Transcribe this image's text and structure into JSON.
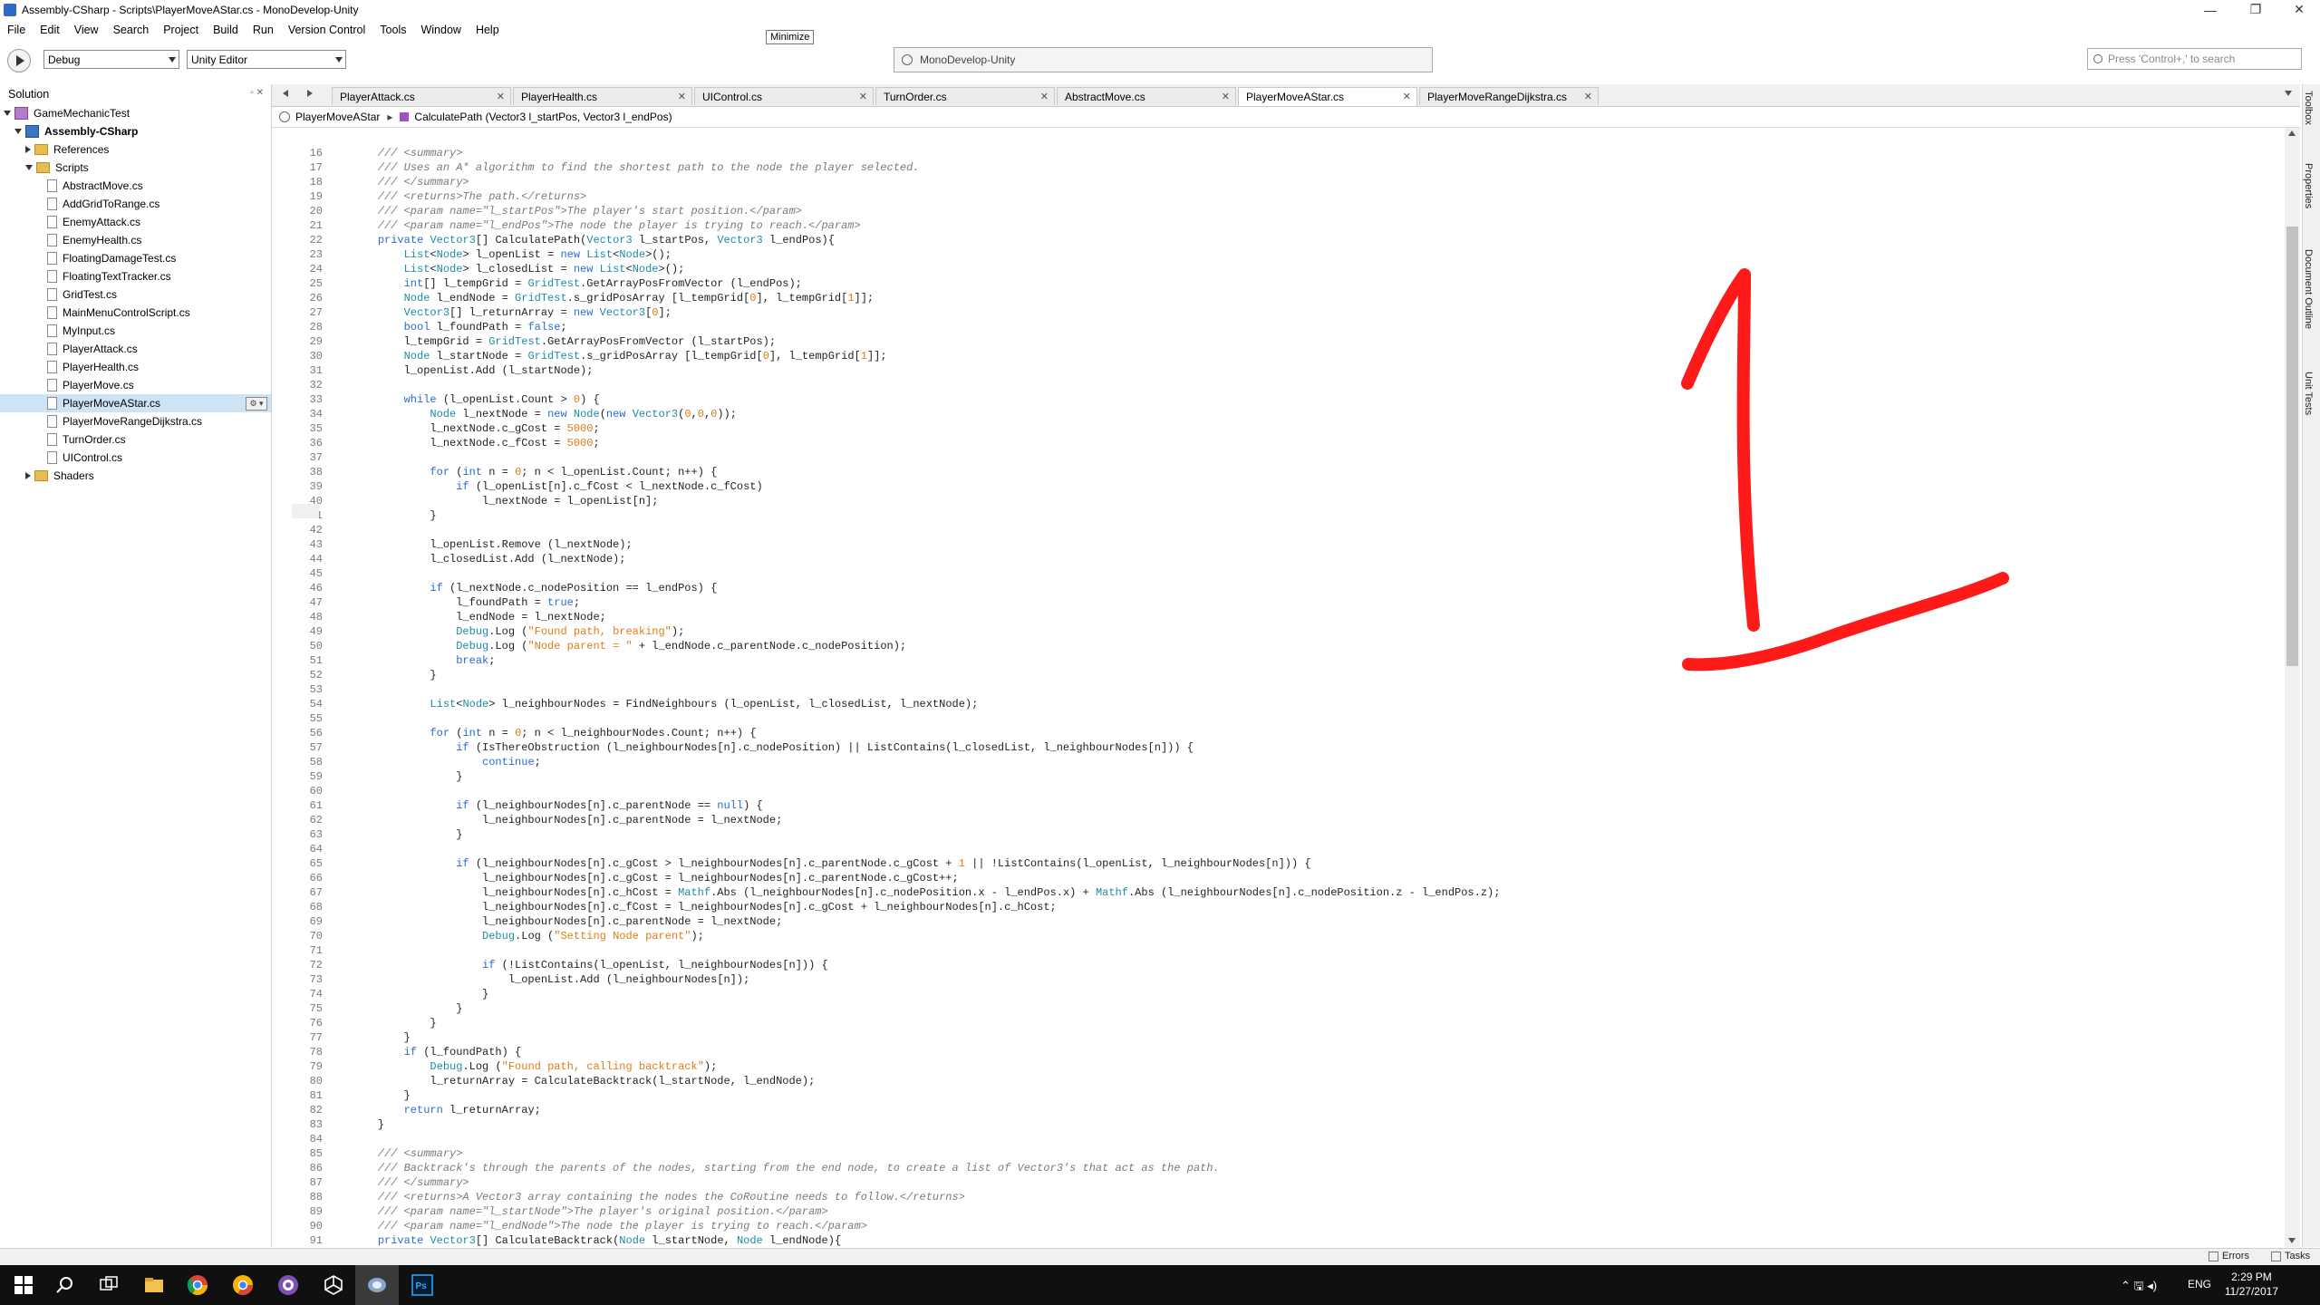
{
  "window": {
    "title": "Assembly-CSharp - Scripts\\PlayerMoveAStar.cs - MonoDevelop-Unity",
    "min_glyph": "—",
    "max_glyph": "❐",
    "close_glyph": "✕",
    "tooltip": "Minimize"
  },
  "menu": [
    "File",
    "Edit",
    "View",
    "Search",
    "Project",
    "Build",
    "Run",
    "Version Control",
    "Tools",
    "Window",
    "Help"
  ],
  "toolbar": {
    "config": "Debug",
    "target": "Unity Editor",
    "status_text": "MonoDevelop-Unity",
    "search_placeholder": "Press 'Control+,' to search"
  },
  "solution": {
    "header": "Solution",
    "header_buttons": "▫ ✕",
    "root": "GameMechanicTest",
    "project": "Assembly-CSharp",
    "references": "References",
    "scripts_folder": "Scripts",
    "files": [
      "AbstractMove.cs",
      "AddGridToRange.cs",
      "EnemyAttack.cs",
      "EnemyHealth.cs",
      "FloatingDamageTest.cs",
      "FloatingTextTracker.cs",
      "GridTest.cs",
      "MainMenuControlScript.cs",
      "MyInput.cs",
      "PlayerAttack.cs",
      "PlayerHealth.cs",
      "PlayerMove.cs",
      "PlayerMoveAStar.cs",
      "PlayerMoveRangeDijkstra.cs",
      "TurnOrder.cs",
      "UIControl.cs"
    ],
    "selected_index": 12,
    "shaders_folder": "Shaders",
    "selected_gear": "⚙ ▾"
  },
  "tabs": [
    {
      "label": "PlayerAttack.cs",
      "active": false
    },
    {
      "label": "PlayerHealth.cs",
      "active": false
    },
    {
      "label": "UIControl.cs",
      "active": false
    },
    {
      "label": "TurnOrder.cs",
      "active": false
    },
    {
      "label": "AbstractMove.cs",
      "active": false
    },
    {
      "label": "PlayerMoveAStar.cs",
      "active": true
    },
    {
      "label": "PlayerMoveRangeDijkstra.cs",
      "active": false
    }
  ],
  "tab_close_glyph": "✕",
  "breadcrumb": {
    "class_name": "PlayerMoveAStar",
    "separator": "▸",
    "method": "CalculatePath (Vector3 l_startPos, Vector3 l_endPos)"
  },
  "code": {
    "first_line": 16,
    "current_line": 41,
    "lines": [
      "    /// <summary>",
      "    /// Uses an A* algorithm to find the shortest path to the node the player selected.",
      "    /// </summary>",
      "    /// <returns>The path.</returns>",
      "    /// <param name=\"l_startPos\">The player's start position.</param>",
      "    /// <param name=\"l_endPos\">The node the player is trying to reach.</param>",
      "    private Vector3[] CalculatePath(Vector3 l_startPos, Vector3 l_endPos){",
      "        List<Node> l_openList = new List<Node>();",
      "        List<Node> l_closedList = new List<Node>();",
      "        int[] l_tempGrid = GridTest.GetArrayPosFromVector (l_endPos);",
      "        Node l_endNode = GridTest.s_gridPosArray [l_tempGrid[0], l_tempGrid[1]];",
      "        Vector3[] l_returnArray = new Vector3[0];",
      "        bool l_foundPath = false;",
      "        l_tempGrid = GridTest.GetArrayPosFromVector (l_startPos);",
      "        Node l_startNode = GridTest.s_gridPosArray [l_tempGrid[0], l_tempGrid[1]];",
      "        l_openList.Add (l_startNode);",
      "",
      "        while (l_openList.Count > 0) {",
      "            Node l_nextNode = new Node(new Vector3(0,0,0));",
      "            l_nextNode.c_gCost = 5000;",
      "            l_nextNode.c_fCost = 5000;",
      "",
      "            for (int n = 0; n < l_openList.Count; n++) {",
      "                if (l_openList[n].c_fCost < l_nextNode.c_fCost)",
      "                    l_nextNode = l_openList[n];",
      "            }",
      "",
      "            l_openList.Remove (l_nextNode);",
      "            l_closedList.Add (l_nextNode);",
      "",
      "            if (l_nextNode.c_nodePosition == l_endPos) {",
      "                l_foundPath = true;",
      "                l_endNode = l_nextNode;",
      "                Debug.Log (\"Found path, breaking\");",
      "                Debug.Log (\"Node parent = \" + l_endNode.c_parentNode.c_nodePosition);",
      "                break;",
      "            }",
      "",
      "            List<Node> l_neighbourNodes = FindNeighbours (l_openList, l_closedList, l_nextNode);",
      "",
      "            for (int n = 0; n < l_neighbourNodes.Count; n++) {",
      "                if (IsThereObstruction (l_neighbourNodes[n].c_nodePosition) || ListContains(l_closedList, l_neighbourNodes[n])) {",
      "                    continue;",
      "                }",
      "",
      "                if (l_neighbourNodes[n].c_parentNode == null) {",
      "                    l_neighbourNodes[n].c_parentNode = l_nextNode;",
      "                }",
      "",
      "                if (l_neighbourNodes[n].c_gCost > l_neighbourNodes[n].c_parentNode.c_gCost + 1 || !ListContains(l_openList, l_neighbourNodes[n])) {",
      "                    l_neighbourNodes[n].c_gCost = l_neighbourNodes[n].c_parentNode.c_gCost++;",
      "                    l_neighbourNodes[n].c_hCost = Mathf.Abs (l_neighbourNodes[n].c_nodePosition.x - l_endPos.x) + Mathf.Abs (l_neighbourNodes[n].c_nodePosition.z - l_endPos.z);",
      "                    l_neighbourNodes[n].c_fCost = l_neighbourNodes[n].c_gCost + l_neighbourNodes[n].c_hCost;",
      "                    l_neighbourNodes[n].c_parentNode = l_nextNode;",
      "                    Debug.Log (\"Setting Node parent\");",
      "",
      "                    if (!ListContains(l_openList, l_neighbourNodes[n])) {",
      "                        l_openList.Add (l_neighbourNodes[n]);",
      "                    }",
      "                }",
      "            }",
      "        }",
      "        if (l_foundPath) {",
      "            Debug.Log (\"Found path, calling backtrack\");",
      "            l_returnArray = CalculateBacktrack(l_startNode, l_endNode);",
      "        }",
      "        return l_returnArray;",
      "    }",
      "",
      "    /// <summary>",
      "    /// Backtrack's through the parents of the nodes, starting from the end node, to create a list of Vector3's that act as the path.",
      "    /// </summary>",
      "    /// <returns>A Vector3 array containing the nodes the CoRoutine needs to follow.</returns>",
      "    /// <param name=\"l_startNode\">The player's original position.</param>",
      "    /// <param name=\"l_endNode\">The node the player is trying to reach.</param>",
      "    private Vector3[] CalculateBacktrack(Node l_startNode, Node l_endNode){"
    ]
  },
  "right_dock": [
    "Toolbox",
    "Properties",
    "Document Outline",
    "Unit Tests"
  ],
  "statusbar": {
    "errors": "Errors",
    "tasks": "Tasks"
  },
  "taskbar": {
    "lang": "ENG",
    "time": "2:29 PM",
    "date": "11/27/2017",
    "tray_glyphs": "⌃ 🖫 ◂)"
  },
  "colors": {
    "annotation": "#ff1a1a",
    "keyword": "#2a6bd6",
    "type": "#1e8ca0",
    "comment": "#7a7a7a",
    "string": "#e07c18"
  }
}
